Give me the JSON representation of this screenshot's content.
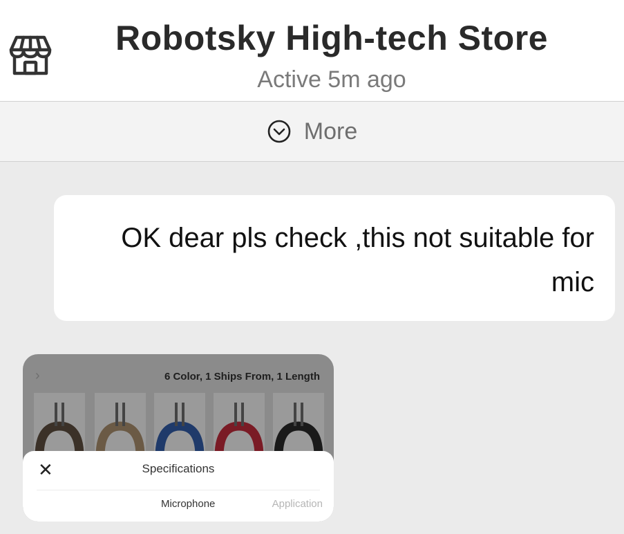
{
  "header": {
    "icon": "store-icon",
    "title": "Robotsky High-tech Store",
    "status": "Active 5m ago"
  },
  "more_bar": {
    "icon": "chevron-down-circle-icon",
    "label": "More"
  },
  "messages": [
    {
      "text": "OK dear pls check ,this not suitable for mic"
    }
  ],
  "image_message": {
    "variant_summary": "6 Color, 1 Ships From, 1 Length",
    "swatch_colors": [
      "#3b3128",
      "#6b5a45",
      "#1f3a6a",
      "#7a1b25",
      "#1a1a1a"
    ],
    "sheet": {
      "title": "Specifications",
      "col_microphone": "Microphone",
      "col_application": "Application"
    }
  }
}
